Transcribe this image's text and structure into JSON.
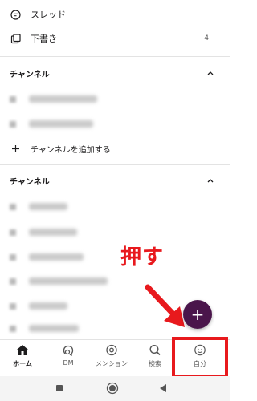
{
  "menu": [
    {
      "label": "スレッド",
      "icon": "threads-icon"
    },
    {
      "label": "下書き",
      "icon": "drafts-icon",
      "count": "4"
    }
  ],
  "channels_section_1": {
    "title": "チャンネル",
    "add_label": "チャンネルを追加する"
  },
  "channels_section_2": {
    "title": "チャンネル"
  },
  "annotation": {
    "text": "押す"
  },
  "fab": {
    "label": "+"
  },
  "tabs": [
    {
      "label": "ホーム",
      "icon": "home-icon",
      "active": true
    },
    {
      "label": "DM",
      "icon": "dm-icon"
    },
    {
      "label": "メンション",
      "icon": "mention-icon"
    },
    {
      "label": "検索",
      "icon": "search-icon"
    },
    {
      "label": "自分",
      "icon": "profile-icon"
    }
  ],
  "colors": {
    "fab": "#4a154b",
    "annotation": "#e8191d",
    "text": "#1d1c1d"
  }
}
